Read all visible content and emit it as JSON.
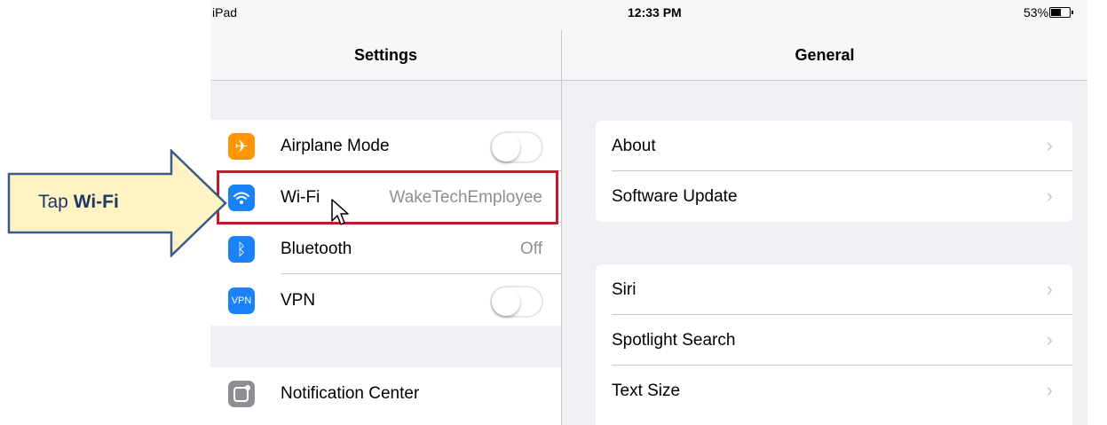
{
  "statusbar": {
    "device": "iPad",
    "time": "12:33 PM",
    "battery": "53%"
  },
  "settings": {
    "title": "Settings",
    "rows": [
      {
        "label": "Airplane Mode",
        "icon": "airplane-icon",
        "color": "#ff9500",
        "glyph": "✈"
      },
      {
        "label": "Wi-Fi",
        "value": "WakeTechEmployee",
        "icon": "wifi-icon",
        "color": "#1a82fb"
      },
      {
        "label": "Bluetooth",
        "value": "Off",
        "icon": "bluetooth-icon",
        "color": "#1a82fb",
        "glyph": "ᛒ"
      },
      {
        "label": "VPN",
        "icon": "vpn-icon",
        "color": "#1a82fb",
        "glyph": "VPN"
      },
      {
        "label": "Notification Center",
        "icon": "notification-center-icon",
        "color": "#8e8e93"
      }
    ]
  },
  "general": {
    "title": "General",
    "group1": [
      "About",
      "Software Update"
    ],
    "group2": [
      "Siri",
      "Spotlight Search",
      "Text Size"
    ]
  },
  "callout": {
    "prefix": "Tap ",
    "bold": "Wi-Fi",
    "color": "#1f3763",
    "fill": "#fdf3c4"
  },
  "highlight_color": "#b5222b"
}
